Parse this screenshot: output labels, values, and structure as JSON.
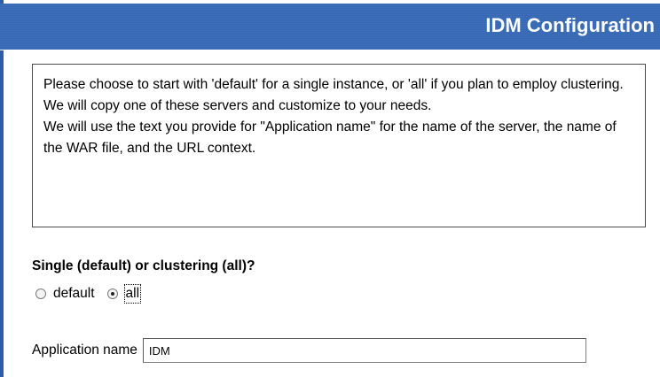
{
  "header": {
    "title": "IDM Configuration"
  },
  "info": {
    "line1": "Please choose to start with 'default' for a single instance, or 'all' if you plan to employ clustering. We will copy one of these servers and customize to your needs.",
    "line2": "We will use the text you provide for \"Application name\" for the name of the server, the name of the WAR file, and the URL context."
  },
  "clustering": {
    "question": "Single (default) or clustering (all)?",
    "options": [
      {
        "label": "default",
        "selected": false
      },
      {
        "label": "all",
        "selected": true
      }
    ]
  },
  "application": {
    "label": "Application name",
    "value": "IDM"
  },
  "colors": {
    "header_bg": "#3567b2",
    "header_text": "#ffffff",
    "left_rail": "#2d5da8"
  }
}
